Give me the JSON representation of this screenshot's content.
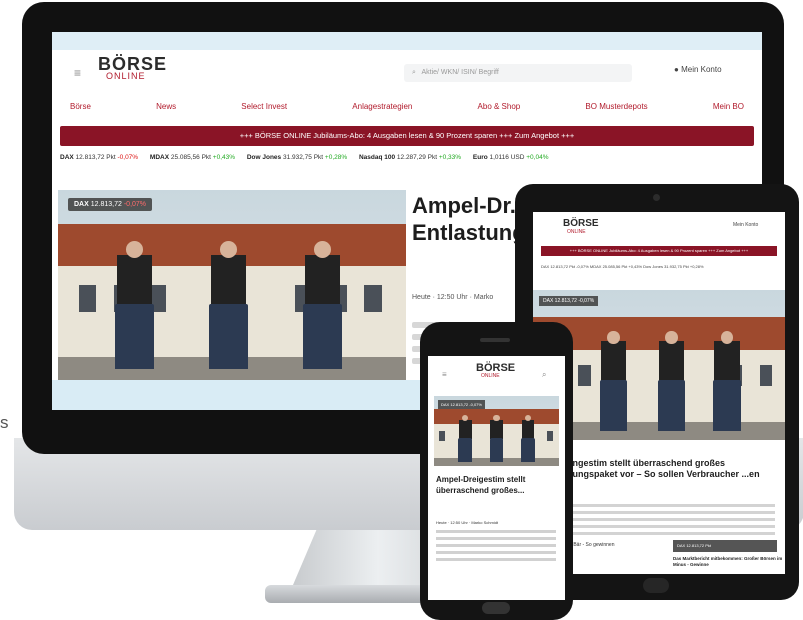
{
  "edge_text": "s",
  "site": {
    "logo_top": "BÖRSE",
    "logo_bottom": "ONLINE",
    "search_placeholder": "Aktie/ WKN/ ISIN/ Begriff",
    "login": "Mein Konto",
    "nav": [
      "Börse",
      "News",
      "Select Invest",
      "Anlagestrategien",
      "Abo & Shop",
      "BO Musterdepots",
      "Mein BO"
    ],
    "promo": "+++ BÖRSE ONLINE Jubiläums-Abo: 4 Ausgaben lesen & 90 Prozent sparen +++ Zum Angebot +++",
    "ticker": [
      {
        "name": "DAX",
        "value": "12.813,72 Pkt",
        "change": "-0,07%",
        "dir": "neg"
      },
      {
        "name": "MDAX",
        "value": "25.085,56 Pkt",
        "change": "+0,43%",
        "dir": "pos"
      },
      {
        "name": "Dow Jones",
        "value": "31.932,75 Pkt",
        "change": "+0,28%",
        "dir": "pos"
      },
      {
        "name": "Nasdaq 100",
        "value": "12.287,29 Pkt",
        "change": "+0,33%",
        "dir": "pos"
      },
      {
        "name": "Euro",
        "value": "1,0116 USD",
        "change": "+0,04%",
        "dir": "pos"
      }
    ],
    "hero_badge_label": "DAX",
    "hero_badge_value": "12.813,72",
    "hero_badge_change": "-0,07%",
    "headline": "Ampel-Dr... überrasch... Entlastung",
    "meta": "Heute · 12:50 Uhr · Marko"
  },
  "tablet": {
    "login": "Mein Konto",
    "promo": "+++ BÖRSE ONLINE Jubiläums-Abo: 4 Ausgaben lesen & 90 Prozent sparen +++ Zum Angebot +++",
    "ticker": "DAX 12.813,72 Pkt -0,07%  MDAX 25.085,56 Pkt +0,43%  Dow Jones 31.932,75 Pkt +0,28%",
    "headline": "...ngestim stellt überraschend großes ...ungspaket vor – So sollen Verbraucher ...en",
    "more": "...e Bär - So gewinnen",
    "card": "DAX 12.813,72 Pkt",
    "bottom": "Das Marktbericht mitbekommen: Großer Börsen im Minus - Gewinne"
  },
  "phone": {
    "headline": "Ampel-Dreigestim stellt überraschend großes...",
    "meta": "Heute · 12:50 Uhr · Marko Schmidt"
  }
}
